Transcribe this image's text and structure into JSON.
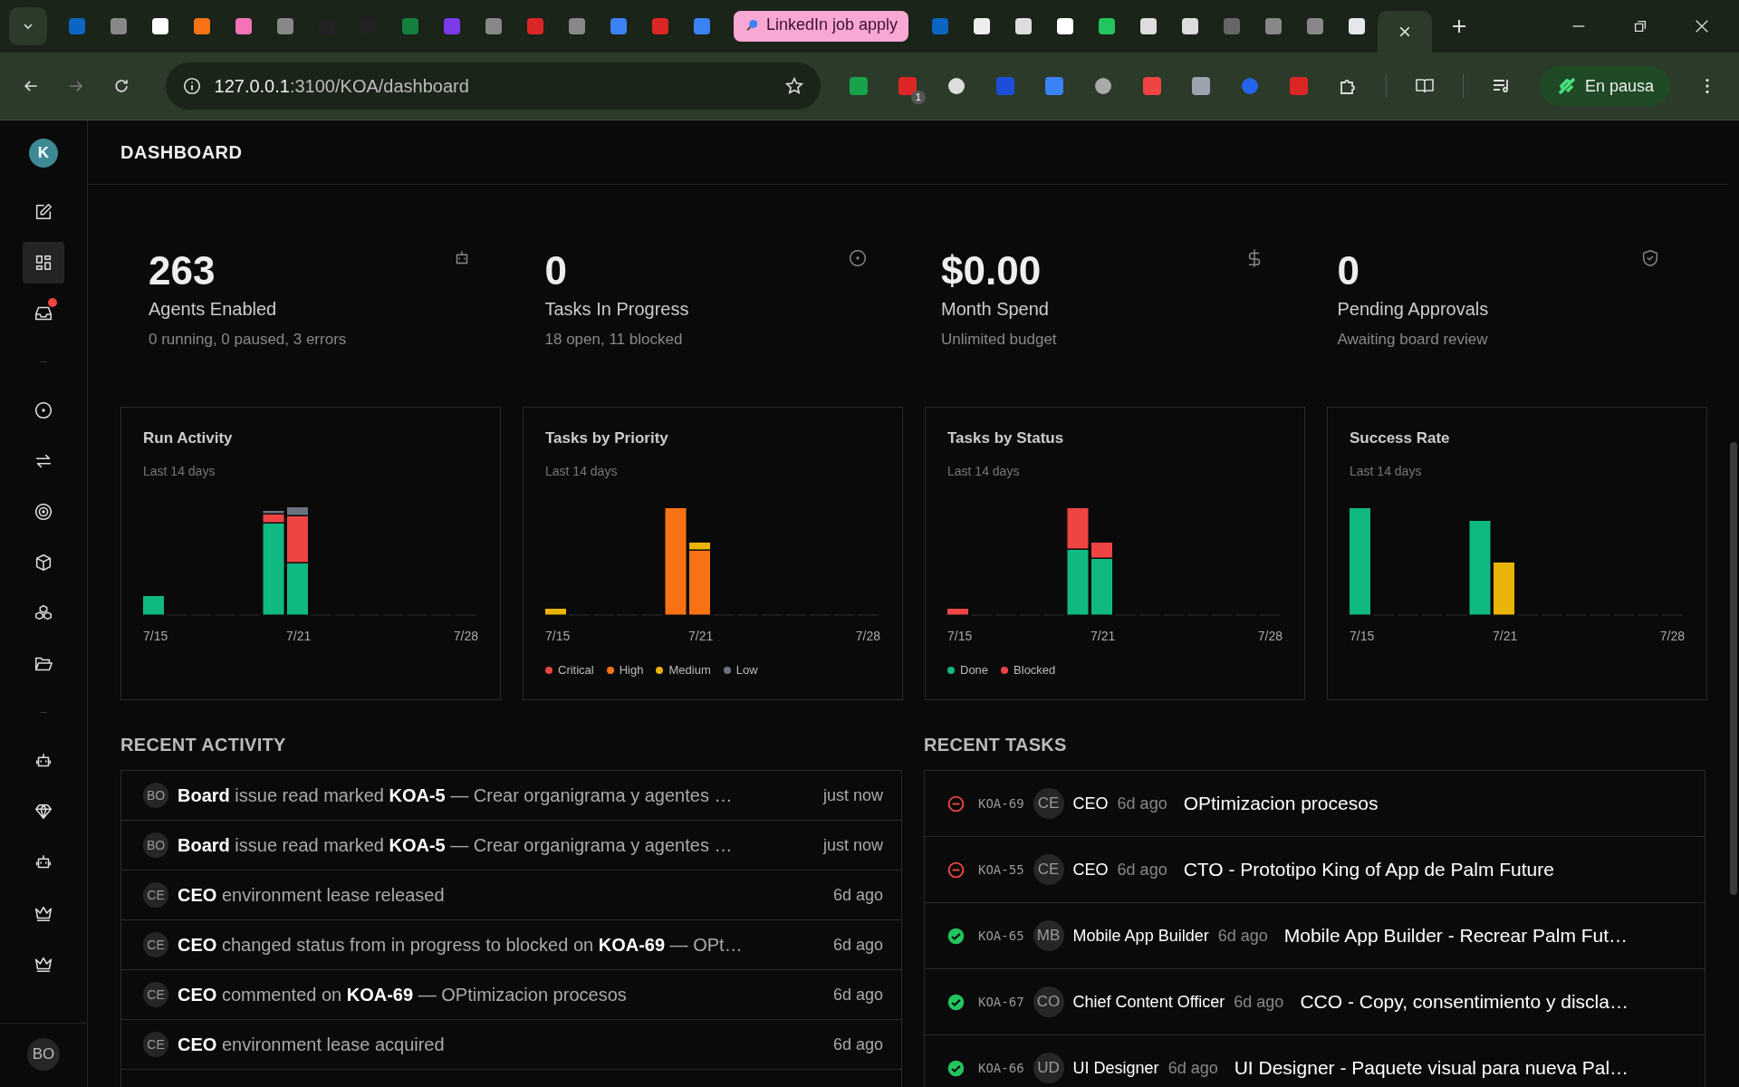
{
  "browser": {
    "tabs": [
      {
        "kind": "icon",
        "selected": false
      },
      {
        "kind": "icon",
        "selected": false
      },
      {
        "kind": "icon",
        "selected": false
      },
      {
        "kind": "icon",
        "selected": false
      },
      {
        "kind": "icon",
        "selected": false
      },
      {
        "kind": "icon",
        "selected": false
      },
      {
        "kind": "icon",
        "selected": false
      },
      {
        "kind": "icon",
        "selected": false
      },
      {
        "kind": "icon",
        "selected": false
      },
      {
        "kind": "icon",
        "selected": false
      },
      {
        "kind": "icon",
        "selected": false
      },
      {
        "kind": "icon",
        "selected": false
      },
      {
        "kind": "icon",
        "selected": false
      },
      {
        "kind": "icon",
        "selected": false
      },
      {
        "kind": "icon",
        "selected": false
      },
      {
        "kind": "icon",
        "selected": false
      },
      {
        "kind": "group",
        "label": "LinkedIn job apply",
        "selected": false
      },
      {
        "kind": "icon",
        "selected": false
      },
      {
        "kind": "icon",
        "selected": false
      },
      {
        "kind": "icon",
        "selected": false
      },
      {
        "kind": "icon",
        "selected": false
      },
      {
        "kind": "icon",
        "selected": false
      },
      {
        "kind": "icon",
        "selected": false
      },
      {
        "kind": "icon",
        "selected": false
      },
      {
        "kind": "icon",
        "selected": false
      },
      {
        "kind": "icon",
        "selected": false
      },
      {
        "kind": "icon",
        "selected": false
      },
      {
        "kind": "icon",
        "selected": false
      },
      {
        "kind": "icon",
        "selected": true
      }
    ],
    "address": {
      "host": "127.0.0.1",
      "path": ":3100/KOA/dashboard"
    },
    "extension_badge": "1",
    "profile": {
      "label": "En pausa"
    }
  },
  "sidebar": {
    "logo": "K",
    "groups": [
      {
        "items": [
          {
            "selected": false
          },
          {
            "selected": true
          },
          {
            "selected": false,
            "notification": true
          }
        ]
      },
      {
        "items": [
          {
            "selected": false
          },
          {
            "selected": false
          },
          {
            "selected": false
          },
          {
            "selected": false
          },
          {
            "selected": false
          },
          {
            "selected": false
          }
        ]
      },
      {
        "items": [
          {
            "selected": false
          },
          {
            "selected": false
          },
          {
            "selected": false
          },
          {
            "selected": false
          },
          {
            "selected": false
          }
        ]
      }
    ],
    "user": "BO"
  },
  "header": {
    "title": "DASHBOARD"
  },
  "stats": [
    {
      "value": "263",
      "label": "Agents Enabled",
      "detail": "0 running, 0 paused, 3 errors"
    },
    {
      "value": "0",
      "label": "Tasks In Progress",
      "detail": "18 open, 11 blocked"
    },
    {
      "value": "$0.00",
      "label": "Month Spend",
      "detail": "Unlimited budget"
    },
    {
      "value": "0",
      "label": "Pending Approvals",
      "detail": "Awaiting board review"
    }
  ],
  "charts": [
    {
      "title": "Run Activity",
      "subtitle": "Last 14 days",
      "dates": [
        "7/15",
        "7/21",
        "7/28"
      ]
    },
    {
      "title": "Tasks by Priority",
      "subtitle": "Last 14 days",
      "dates": [
        "7/15",
        "7/21",
        "7/28"
      ],
      "legend": [
        {
          "label": "Critical",
          "color": "#ef4444"
        },
        {
          "label": "High",
          "color": "#f97316"
        },
        {
          "label": "Medium",
          "color": "#eab308"
        },
        {
          "label": "Low",
          "color": "#6b7280"
        }
      ]
    },
    {
      "title": "Tasks by Status",
      "subtitle": "Last 14 days",
      "dates": [
        "7/15",
        "7/21",
        "7/28"
      ],
      "legend": [
        {
          "label": "Done",
          "color": "#10b981"
        },
        {
          "label": "Blocked",
          "color": "#ef4444"
        }
      ]
    },
    {
      "title": "Success Rate",
      "subtitle": "Last 14 days",
      "dates": [
        "7/15",
        "7/21",
        "7/28"
      ]
    }
  ],
  "recent_activity": {
    "title": "RECENT ACTIVITY",
    "rows": [
      {
        "avatar": "BO",
        "text": "**Board** issue read marked **KOA-5** — Crear organigrama y agentes …",
        "time": "just now"
      },
      {
        "avatar": "BO",
        "text": "**Board** issue read marked **KOA-5** — Crear organigrama y agentes …",
        "time": "just now"
      },
      {
        "avatar": "CE",
        "text": "**CEO** environment lease released",
        "time": "6d ago"
      },
      {
        "avatar": "CE",
        "text": "**CEO** changed status from in progress to blocked on **KOA-69** — OPt…",
        "time": "6d ago"
      },
      {
        "avatar": "CE",
        "text": "**CEO** commented on **KOA-69** — OPtimizacion procesos",
        "time": "6d ago"
      },
      {
        "avatar": "CE",
        "text": "**CEO** environment lease acquired",
        "time": "6d ago"
      }
    ]
  },
  "recent_tasks": {
    "title": "RECENT TASKS",
    "rows": [
      {
        "kind": "blocked",
        "id": "KOA-69",
        "avatar": "CE",
        "assignee": "CEO",
        "time": "6d ago",
        "title": "OPtimizacion procesos"
      },
      {
        "kind": "blocked",
        "id": "KOA-55",
        "avatar": "CE",
        "assignee": "CEO",
        "time": "6d ago",
        "title": "CTO - Prototipo King of App de Palm Future"
      },
      {
        "kind": "done",
        "id": "KOA-65",
        "avatar": "MB",
        "assignee": "Mobile App Builder",
        "time": "6d ago",
        "title": "Mobile App Builder - Recrear Palm Fut…"
      },
      {
        "kind": "done",
        "id": "KOA-67",
        "avatar": "CO",
        "assignee": "Chief Content Officer",
        "time": "6d ago",
        "title": "CCO - Copy, consentimiento y discla…"
      },
      {
        "kind": "done",
        "id": "KOA-66",
        "avatar": "UD",
        "assignee": "UI Designer",
        "time": "6d ago",
        "title": "UI Designer - Paquete visual para nueva Pal…"
      }
    ]
  }
}
